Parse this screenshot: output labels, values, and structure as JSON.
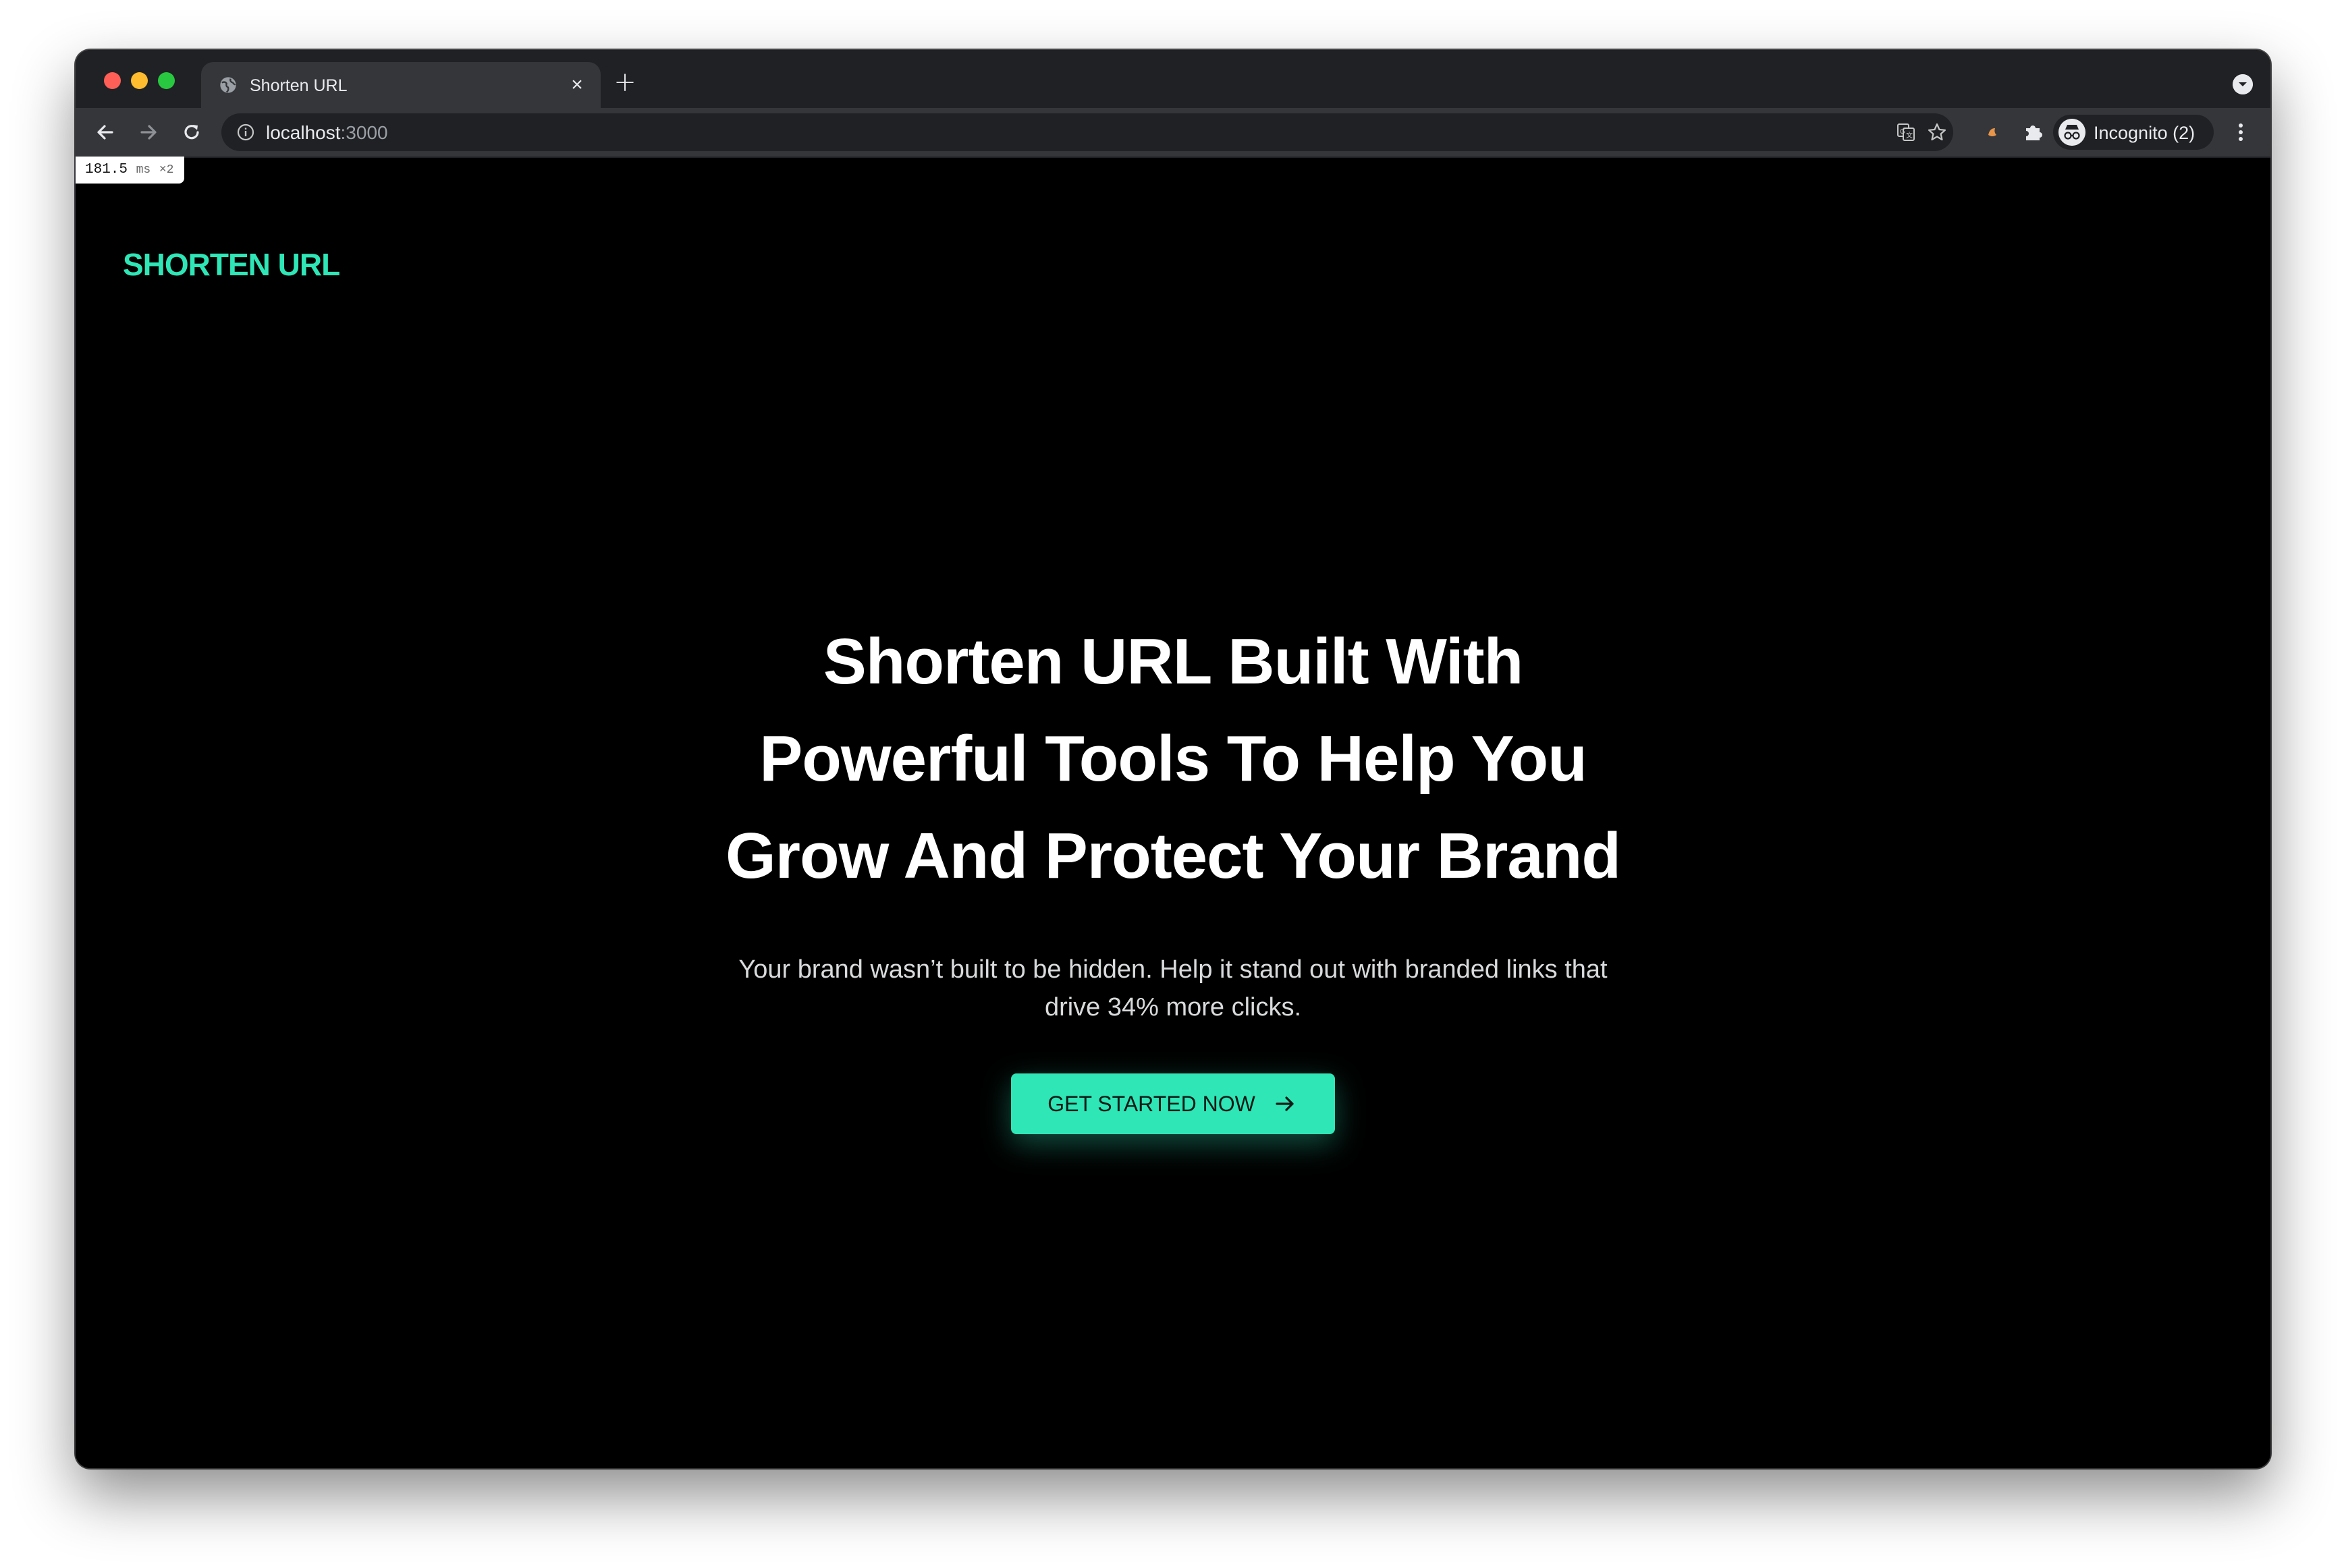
{
  "browser": {
    "tab": {
      "title": "Shorten URL",
      "close_glyph": "×"
    },
    "new_tab_glyph": "+",
    "address": {
      "host": "localhost",
      "port": ":3000"
    },
    "profile": {
      "label": "Incognito (2)"
    },
    "icons": [
      "back-icon",
      "forward-icon",
      "reload-icon",
      "info-icon",
      "translate-icon",
      "star-icon",
      "extension-icon",
      "puzzle-icon",
      "incognito-icon",
      "kebab-menu-icon",
      "tab-search-icon",
      "globe-icon"
    ]
  },
  "perf_badge": {
    "value": "181.5",
    "unit": "ms",
    "multiplier": "×2"
  },
  "site": {
    "logo": "SHORTEN URL",
    "hero": {
      "title_lines": [
        "Shorten URL Built With",
        "Powerful Tools To Help You",
        "Grow And Protect Your Brand"
      ],
      "subtitle_lines": [
        "Your brand wasn’t built to be hidden. Help it stand out with branded links that",
        "drive 34% more clicks."
      ],
      "cta_label": "GET STARTED NOW"
    }
  },
  "colors": {
    "accent": "#2ee6b6",
    "page_bg": "#000000",
    "chrome_dark": "#202124",
    "chrome_toolbar": "#35363a"
  }
}
